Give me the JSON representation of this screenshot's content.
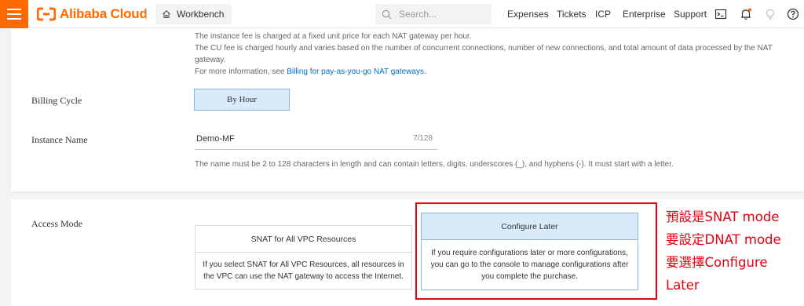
{
  "topbar": {
    "brand": "Alibaba Cloud",
    "workbench_label": "Workbench",
    "search_placeholder": "Search...",
    "nav": [
      "Expenses",
      "Tickets",
      "ICP",
      "Enterprise",
      "Support"
    ],
    "brand_color": "#ff6a00"
  },
  "billing_help": {
    "line1": "The instance fee is charged at a fixed unit price for each NAT gateway per hour.",
    "line2": "The CU fee is charged hourly and varies based on the number of concurrent connections, number of new connections, and total amount of data processed by the NAT",
    "line3": "gateway.",
    "more_prefix": "For more information, see ",
    "more_link": "Billing for pay-as-you-go NAT gateways",
    "more_suffix": "."
  },
  "billing_cycle": {
    "label": "Billing Cycle",
    "option": "By Hour"
  },
  "instance_name": {
    "label": "Instance Name",
    "value": "Demo-MF",
    "count": "7/128",
    "hint": "The name must be 2 to 128 characters in length and can contain letters, digits, underscores (_), and hyphens (-). It must start with a letter."
  },
  "access_mode": {
    "label": "Access Mode",
    "options": [
      {
        "title": "SNAT for All VPC Resources",
        "desc": "If you select SNAT for All VPC Resources, all resources in the VPC can use the NAT gateway to access the Internet."
      },
      {
        "title": "Configure Later",
        "desc": "If you require configurations later or more configurations, you can go to the console to manage configurations after you complete the purchase."
      }
    ]
  },
  "annotation": {
    "lines": [
      "預設是SNAT mode",
      "要設定DNAT mode",
      "要選擇Configure",
      "Later"
    ],
    "color": "#e60012"
  }
}
